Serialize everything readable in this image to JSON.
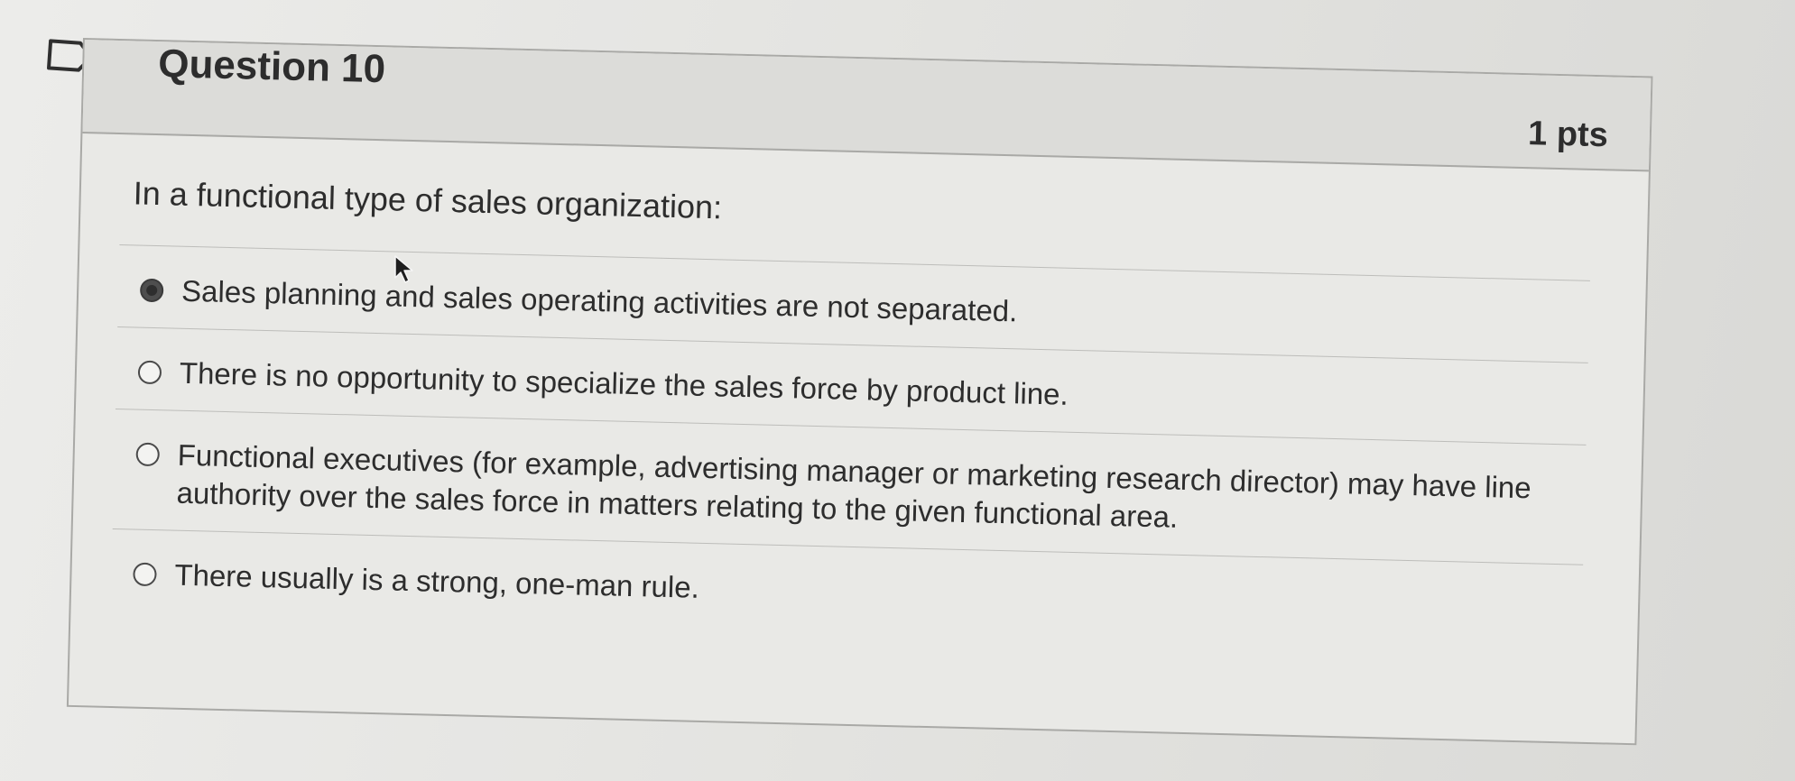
{
  "question": {
    "title": "Question 10",
    "points": "1 pts",
    "text": "In a functional type of sales organization:",
    "answers": [
      {
        "label": "Sales planning and sales operating activities are not separated.",
        "selected": true
      },
      {
        "label": "There is no opportunity to specialize the sales force by product line.",
        "selected": false
      },
      {
        "label": "Functional executives (for example, advertising manager or marketing research director) may have line authority over the sales force in matters relating to the given functional area.",
        "selected": false
      },
      {
        "label": "There usually is a strong, one-man rule.",
        "selected": false
      }
    ]
  },
  "icons": {
    "flag": "flag-icon",
    "cursor": "mouse-cursor-icon"
  },
  "colors": {
    "border": "#a9a9a6",
    "header_bg": "#dcdcd9",
    "body_bg": "#e9e9e6",
    "text": "#2d2d2d"
  }
}
